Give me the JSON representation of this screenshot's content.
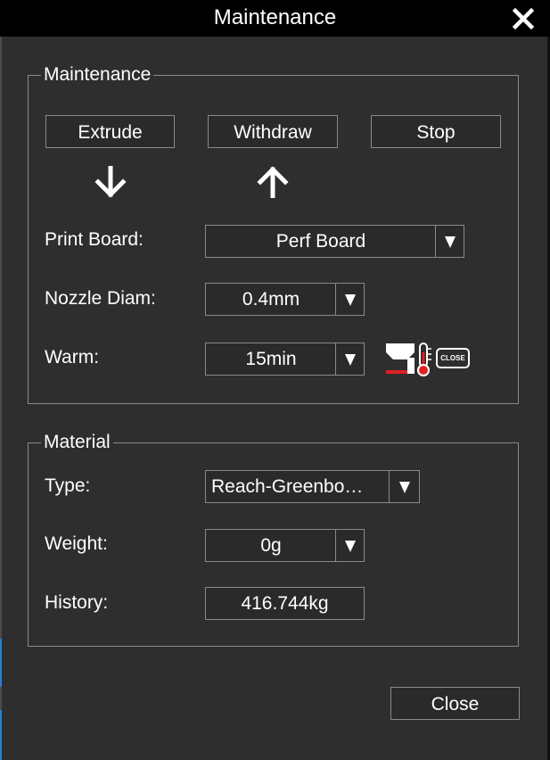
{
  "dialog": {
    "title": "Maintenance",
    "close_label": "Close"
  },
  "maintenance": {
    "legend": "Maintenance",
    "extrude_label": "Extrude",
    "withdraw_label": "Withdraw",
    "stop_label": "Stop",
    "print_board_label": "Print Board:",
    "print_board_value": "Perf Board",
    "nozzle_label": "Nozzle Diam:",
    "nozzle_value": "0.4mm",
    "warm_label": "Warm:",
    "warm_value": "15min",
    "warm_icon": "heater-thermometer-icon",
    "warm_close_badge": "CLOSE"
  },
  "material": {
    "legend": "Material",
    "type_label": "Type:",
    "type_value": "Reach-Greenbo…",
    "weight_label": "Weight:",
    "weight_value": "0g",
    "history_label": "History:",
    "history_value": "416.744kg"
  },
  "colors": {
    "background": "#2e2e2e",
    "titlebar": "#000000",
    "border": "#8a8a8a",
    "accent": "#2a7fd4",
    "thermo_red": "#e02020"
  }
}
